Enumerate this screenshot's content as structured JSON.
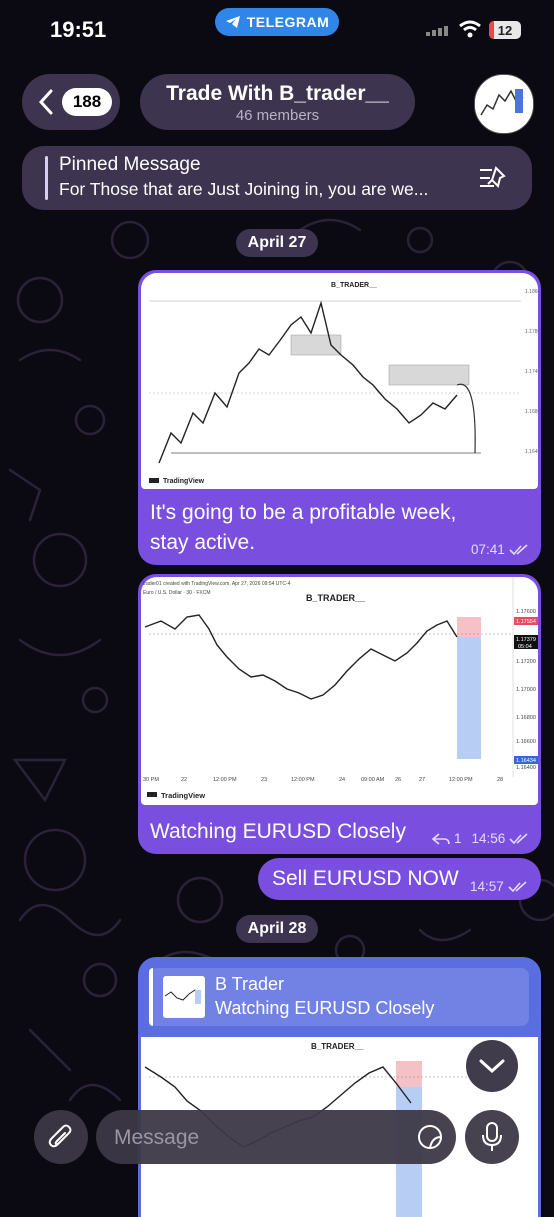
{
  "status_bar": {
    "time": "19:51",
    "app_pill": "TELEGRAM",
    "battery": "12"
  },
  "header": {
    "back_count": "188",
    "title": "Trade With B_trader__",
    "subtitle": "46 members"
  },
  "pinned": {
    "title": "Pinned Message",
    "text": "For Those that are Just Joining in, you are we..."
  },
  "dates": [
    "April 27",
    "April 28"
  ],
  "messages": [
    {
      "chart_title": "B_TRADER__",
      "caption_line1": "It's going to be a profitable week,",
      "caption_line2": "stay active.",
      "time": "07:41"
    },
    {
      "chart_title": "B_TRADER__",
      "chart_header": "trader01 created with TradingView.com, Apr 27, 2026 09:54 UTC-4",
      "symbol": "Euro / U.S. Dollar · 30 · FXCM",
      "prices": [
        "1.17600",
        "1.17554",
        "1.17379",
        "05:04",
        "1.17200",
        "1.17000",
        "1.16800",
        "1.16600",
        "1.16434",
        "1.16400"
      ],
      "dates": [
        "30 PM",
        "22",
        "12:00 PM",
        "23",
        "12:00 PM",
        "24",
        "09:00 AM",
        "26",
        "27",
        "12:00 PM",
        "28"
      ],
      "brand": "TradingView",
      "caption": "Watching EURUSD Closely",
      "replies": "1",
      "time": "14:56"
    },
    {
      "caption": "Sell EURUSD NOW",
      "time": "14:57"
    },
    {
      "reply_name": "B Trader",
      "reply_text": "Watching EURUSD Closely",
      "chart_title": "B_TRADER__"
    }
  ],
  "composer": {
    "placeholder": "Message"
  },
  "icons": {
    "back": "chevron-left-icon",
    "pin_list": "pin-list-icon",
    "attach": "paperclip-icon",
    "sticker": "sticker-icon",
    "mic": "microphone-icon",
    "scroll_down": "chevron-down-icon"
  }
}
